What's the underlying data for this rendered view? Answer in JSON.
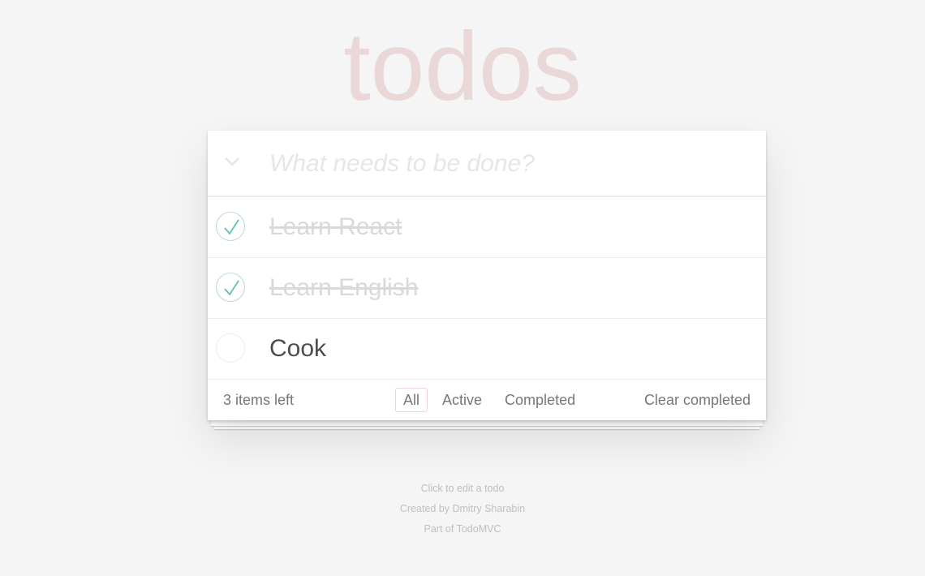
{
  "app": {
    "title": "todos"
  },
  "new_todo": {
    "placeholder": "What needs to be done?",
    "value": ""
  },
  "toggle_all": {
    "icon": "chevron-down-icon"
  },
  "todos": [
    {
      "label": "Learn React",
      "completed": true
    },
    {
      "label": "Learn English",
      "completed": true
    },
    {
      "label": "Cook",
      "completed": false
    }
  ],
  "footer": {
    "count_label": "3 items left",
    "filters": [
      "All",
      "Active",
      "Completed"
    ],
    "selected_filter": "All",
    "clear_label": "Clear completed"
  },
  "info": {
    "line1": "Click to edit a todo",
    "line2": "Created by Dmitry Sharabin",
    "line3": "Part of TodoMVC"
  },
  "colors": {
    "background": "#f5f5f5",
    "title": "#ead7d7",
    "check": "#5dc2af",
    "completed_text": "#d9d9d9"
  }
}
